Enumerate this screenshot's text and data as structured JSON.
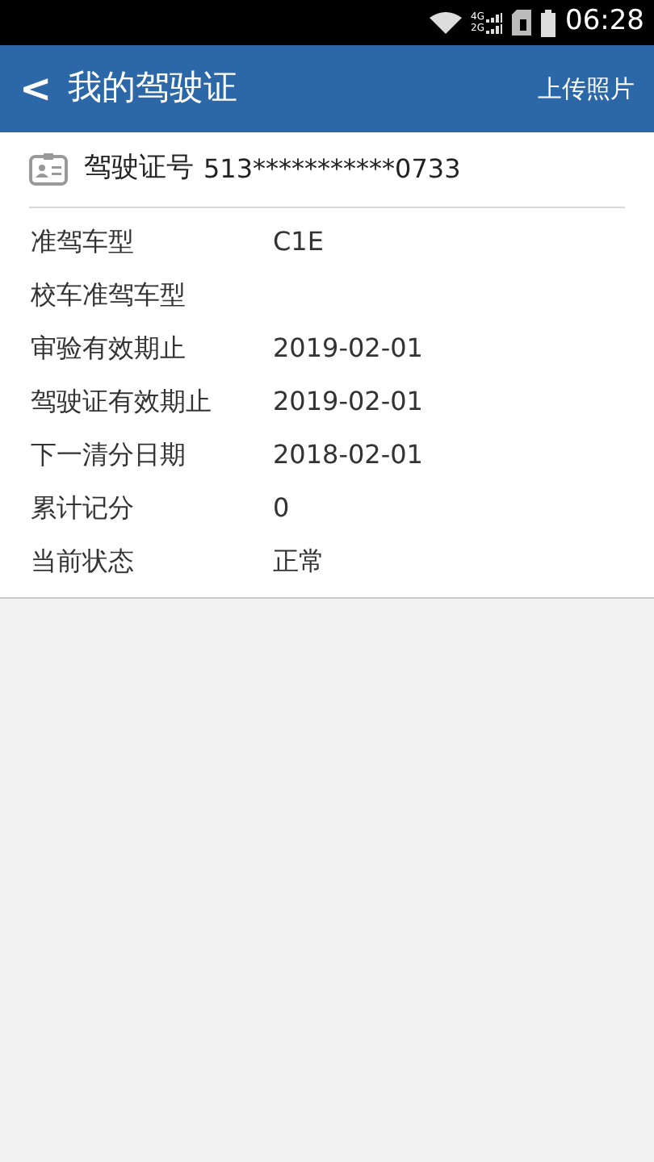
{
  "status_bar": {
    "network_labels": [
      "4G",
      "2G"
    ],
    "time": "06:28"
  },
  "header": {
    "back": "<",
    "title": "我的驾驶证",
    "action": "上传照片"
  },
  "license": {
    "label": "驾驶证号",
    "number": "513***********0733"
  },
  "fields": [
    {
      "label": "准驾车型",
      "value": "C1E"
    },
    {
      "label": "校车准驾车型"
    },
    {
      "label": "审验有效期止",
      "value": "2019-02-01"
    },
    {
      "label": "驾驶证有效期止",
      "value": "2019-02-01"
    },
    {
      "label": "下一清分日期",
      "value": "2018-02-01"
    },
    {
      "label": "累计记分",
      "value": "0"
    },
    {
      "label": "当前状态",
      "value": "正常"
    }
  ]
}
